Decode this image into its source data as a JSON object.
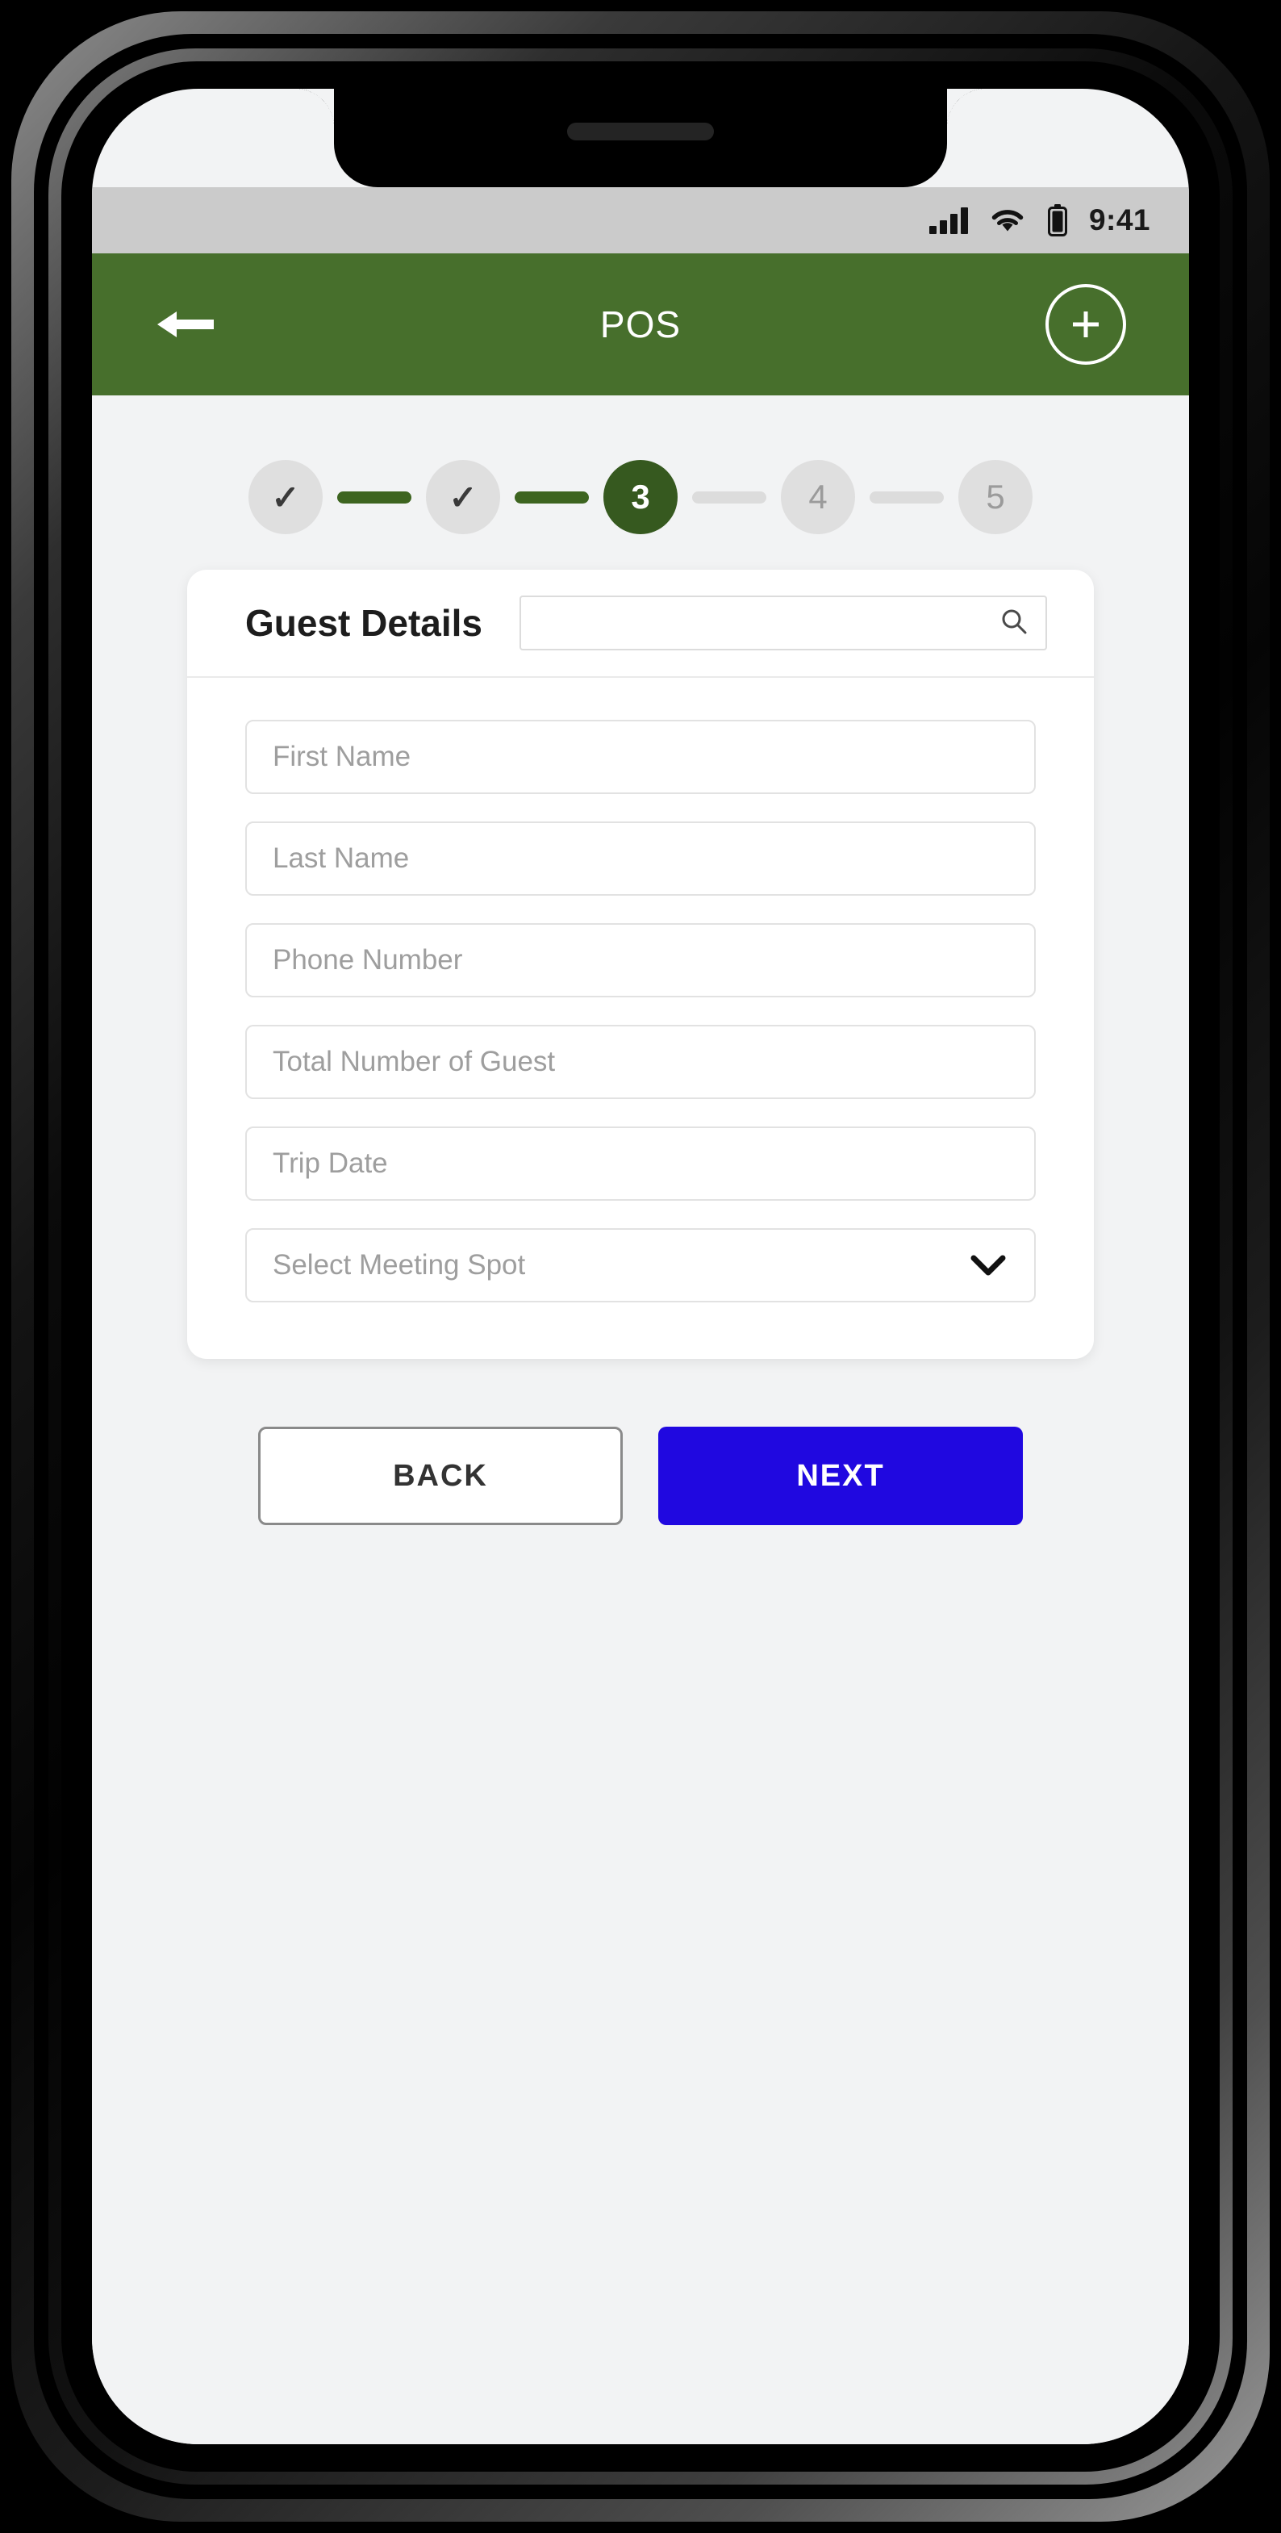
{
  "status_bar": {
    "time": "9:41",
    "signal_icon": "signal-bars-icon",
    "wifi_icon": "wifi-icon",
    "battery_icon": "battery-icon"
  },
  "app_bar": {
    "title": "POS",
    "back_icon": "arrow-left-icon",
    "add_icon": "plus-icon"
  },
  "stepper": {
    "steps": [
      {
        "label": "✓",
        "state": "done"
      },
      {
        "label": "✓",
        "state": "done"
      },
      {
        "label": "3",
        "state": "active"
      },
      {
        "label": "4",
        "state": "todo"
      },
      {
        "label": "5",
        "state": "todo"
      }
    ],
    "connectors": [
      "filled",
      "filled",
      "empty",
      "empty"
    ]
  },
  "card": {
    "title": "Guest Details",
    "search": {
      "value": "",
      "placeholder": "",
      "icon": "search-icon"
    },
    "fields": [
      {
        "name": "first-name",
        "placeholder": "First Name",
        "value": "",
        "type": "text"
      },
      {
        "name": "last-name",
        "placeholder": "Last Name",
        "value": "",
        "type": "text"
      },
      {
        "name": "phone-number",
        "placeholder": "Phone Number",
        "value": "",
        "type": "text"
      },
      {
        "name": "total-number-of-guest",
        "placeholder": "Total Number of Guest",
        "value": "",
        "type": "text"
      },
      {
        "name": "trip-date",
        "placeholder": "Trip Date",
        "value": "",
        "type": "text"
      },
      {
        "name": "select-meeting-spot",
        "placeholder": "Select Meeting Spot",
        "value": "",
        "type": "select",
        "icon": "chevron-down-icon"
      }
    ]
  },
  "actions": {
    "back_label": "BACK",
    "next_label": "NEXT"
  },
  "colors": {
    "app_bar_green": "#476f2c",
    "step_active_green": "#36591f",
    "step_connector_green": "#3d641f",
    "next_button_blue": "#2008e0",
    "screen_background": "#f2f3f4",
    "status_bar_gray": "#cbcbcb",
    "card_white": "#ffffff",
    "placeholder_gray": "#9e9e9e"
  }
}
